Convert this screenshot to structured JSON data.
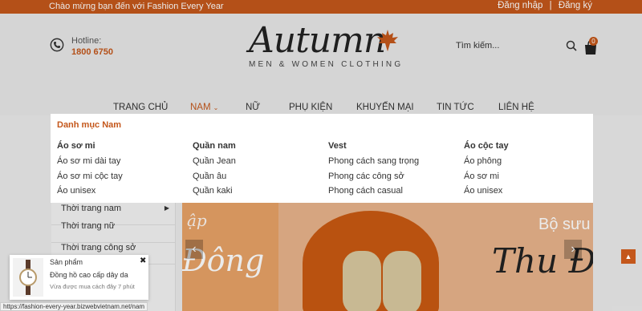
{
  "topbar": {
    "welcome": "Chào mừng bạn đến với Fashion Every Year",
    "login": "Đăng nhập",
    "separator": "|",
    "register": "Đăng ký"
  },
  "hotline": {
    "label": "Hotline:",
    "number": "1800 6750"
  },
  "logo": {
    "script": "Autumn",
    "tagline": "MEN & WOMEN CLOTHING"
  },
  "search": {
    "placeholder": "Tìm kiếm..."
  },
  "cart": {
    "count": "0"
  },
  "nav": {
    "items": [
      "TRANG CHỦ",
      "NAM",
      "NỮ",
      "PHỤ KIỆN",
      "KHUYẾN MẠI",
      "TIN TỨC",
      "LIÊN HỆ"
    ]
  },
  "mega": {
    "title": "Danh mục Nam",
    "columns": [
      {
        "head": "Áo sơ mi",
        "links": [
          "Áo sơ mi dài tay",
          "Áo sơ mi cộc tay",
          "Áo unisex"
        ]
      },
      {
        "head": "Quần nam",
        "links": [
          "Quần Jean",
          "Quần âu",
          "Quần kaki"
        ]
      },
      {
        "head": "Vest",
        "links": [
          "Phong cách sang trọng",
          "Phong các công sở",
          "Phong cách casual"
        ]
      },
      {
        "head": "Áo cộc tay",
        "links": [
          "Áo phông",
          "Áo sơ mi",
          "Áo unisex"
        ]
      }
    ]
  },
  "sidebar": {
    "items": [
      "Thời trang nam",
      "Thời trang nữ",
      "Thời trang công sở"
    ]
  },
  "banner": {
    "left_small": "ập",
    "left_big": "Đông",
    "right_small": "Bộ sưu t",
    "right_big": "Thu Đ"
  },
  "popup": {
    "title": "Sản phẩm",
    "name": "Đồng hồ cao cấp dây da",
    "time": "Vừa được mua cách đây 7 phút"
  },
  "statusbar": {
    "url": "https://fashion-every-year.bizwebvietnam.net/nam"
  }
}
